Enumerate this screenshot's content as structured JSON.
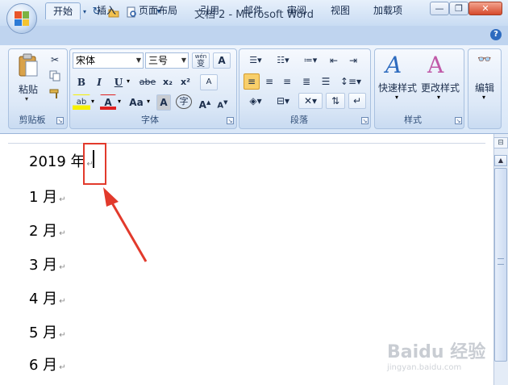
{
  "window": {
    "title": "文档 2 - Microsoft Word",
    "minimize": "—",
    "restore": "❐",
    "close": "✕"
  },
  "qat": {
    "save_icon": "floppy-icon",
    "undo_icon": "undo-icon",
    "redo_icon": "redo-icon",
    "open_icon": "folder-icon",
    "preview_icon": "print-preview-icon",
    "customize": "▾"
  },
  "tabs": [
    "开始",
    "插入",
    "页面布局",
    "引用",
    "邮件",
    "审阅",
    "视图",
    "加载项"
  ],
  "help": "?",
  "ribbon": {
    "clipboard": {
      "label": "剪贴板",
      "paste": "粘贴"
    },
    "font": {
      "label": "字体",
      "font_name": "宋体",
      "font_size": "三号",
      "wen": "wén",
      "wen_char": "变",
      "char_border": "A",
      "bold": "B",
      "italic": "I",
      "underline": "U",
      "strike": "abe",
      "subscript": "x₂",
      "superscript": "x²",
      "clear": "A",
      "highlight": "ab",
      "font_color": "A",
      "change_case": "Aa",
      "shading": "A",
      "enclose": "字",
      "grow": "A",
      "shrink": "A"
    },
    "paragraph": {
      "label": "段落"
    },
    "styles": {
      "label": "样式",
      "quick": "快速样式",
      "change": "更改样式"
    },
    "editing": {
      "label": "编辑"
    }
  },
  "document": {
    "lines": [
      "2019 年",
      "1 月",
      "2 月",
      "3 月",
      "4 月",
      "5 月",
      "6 月"
    ],
    "para_mark": "↵"
  },
  "watermark": {
    "main": "Baidu 经验",
    "sub": "jingyan.baidu.com"
  },
  "colors": {
    "accent": "#2d6bbf",
    "annotation_red": "#e23a2c"
  }
}
